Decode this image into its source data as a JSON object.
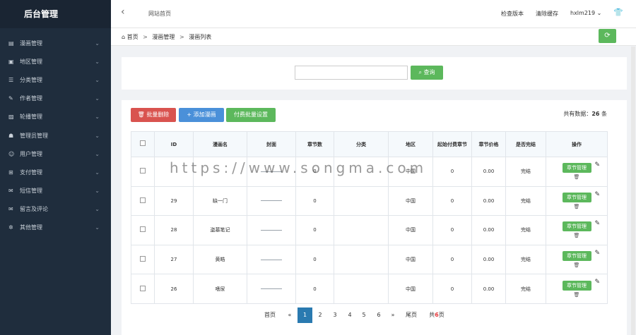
{
  "sidebar": {
    "title": "后台管理",
    "items": [
      {
        "label": "漫画管理",
        "icon": "book-icon"
      },
      {
        "label": "地区管理",
        "icon": "map-icon"
      },
      {
        "label": "分类管理",
        "icon": "list-icon"
      },
      {
        "label": "作者管理",
        "icon": "user-edit-icon"
      },
      {
        "label": "轮播管理",
        "icon": "image-icon"
      },
      {
        "label": "管理员管理",
        "icon": "admin-icon"
      },
      {
        "label": "用户管理",
        "icon": "users-icon"
      },
      {
        "label": "支付管理",
        "icon": "cart-icon"
      },
      {
        "label": "短信管理",
        "icon": "sms-icon"
      },
      {
        "label": "留言及评论",
        "icon": "comment-icon"
      },
      {
        "label": "其他管理",
        "icon": "gear-icon"
      }
    ]
  },
  "topbar": {
    "site_home": "网站首页",
    "check_version": "检查版本",
    "clear_cache": "清除缓存",
    "username": "hxlm219"
  },
  "breadcrumb": {
    "home": "首页",
    "section": "漫画管理",
    "page": "漫画列表"
  },
  "search": {
    "value": "",
    "button": "查询"
  },
  "toolbar": {
    "batch_delete": "批量删除",
    "add_comic": "添加漫画",
    "batch_pay_settings": "付费批量设置",
    "total_prefix": "共有数据：",
    "total_count": "26",
    "total_suffix": "条"
  },
  "table": {
    "headers": [
      "",
      "ID",
      "漫画名",
      "封面",
      "章节数",
      "分类",
      "地区",
      "起始付费章节",
      "章节价格",
      "是否完结",
      "操作"
    ],
    "chapter_button": "章节管理",
    "rows": [
      {
        "id": "",
        "name": "",
        "chapters": "0",
        "category": "",
        "region": "中国",
        "start_pay": "0",
        "price": "0.00",
        "finished": "完结"
      },
      {
        "id": "29",
        "name": "缺一门",
        "chapters": "0",
        "category": "",
        "region": "中国",
        "start_pay": "0",
        "price": "0.00",
        "finished": "完结"
      },
      {
        "id": "28",
        "name": "盗墓笔记",
        "chapters": "0",
        "category": "",
        "region": "中国",
        "start_pay": "0",
        "price": "0.00",
        "finished": "完结"
      },
      {
        "id": "27",
        "name": "黄皓",
        "chapters": "0",
        "category": "",
        "region": "中国",
        "start_pay": "0",
        "price": "0.00",
        "finished": "完结"
      },
      {
        "id": "26",
        "name": "嗜尿",
        "chapters": "0",
        "category": "",
        "region": "中国",
        "start_pay": "0",
        "price": "0.00",
        "finished": "完结"
      }
    ]
  },
  "pagination": {
    "first": "首页",
    "prev": "«",
    "pages": [
      "1",
      "2",
      "3",
      "4",
      "5",
      "6"
    ],
    "current": "1",
    "next": "»",
    "last": "尾页",
    "total_prefix": "共",
    "total_pages": "6",
    "total_suffix": "页"
  },
  "watermark": "https://www.songma.com",
  "colors": {
    "sidebar_bg": "#1f2d3d",
    "success": "#5cb85c",
    "danger": "#d9534f",
    "primary": "#4a90d9",
    "active_page": "#2a7ab0"
  }
}
